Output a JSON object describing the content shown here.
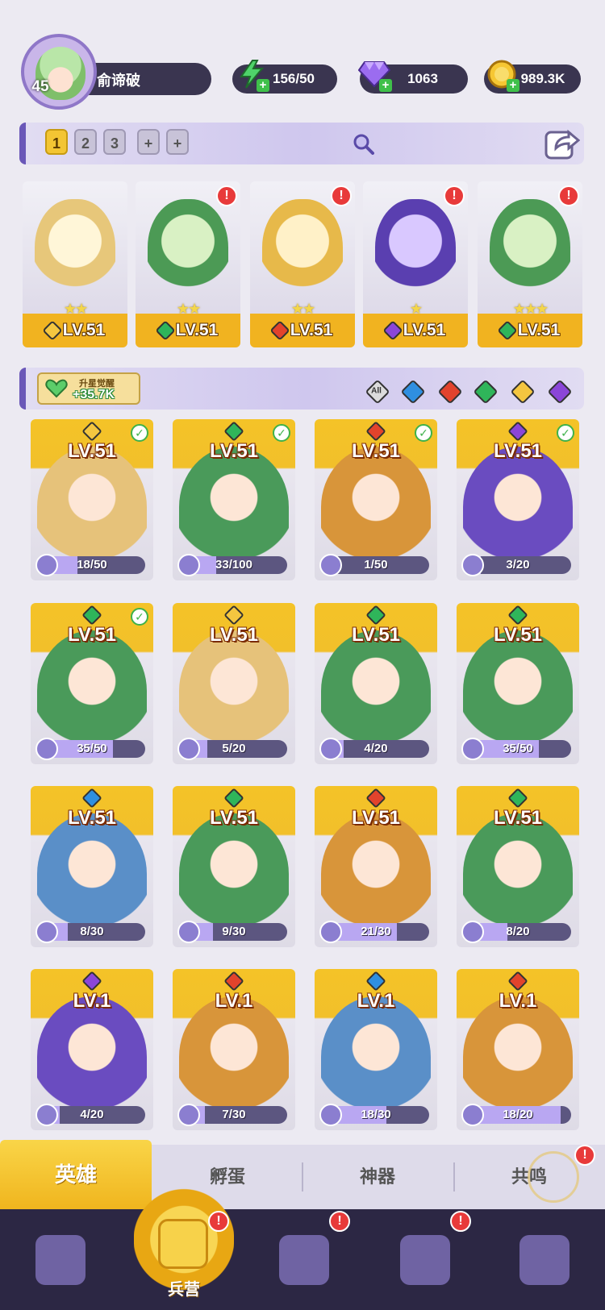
{
  "player": {
    "level": "45",
    "name": "俞谛破"
  },
  "resources": {
    "energy": "156/50",
    "gems": "1063",
    "gold": "989.3K"
  },
  "team_tabs": [
    "1",
    "2",
    "3",
    "+",
    "+"
  ],
  "team": [
    {
      "level": "LV.51",
      "element": "light",
      "stars": "★★",
      "alert": false
    },
    {
      "level": "LV.51",
      "element": "nature",
      "stars": "★★",
      "alert": true
    },
    {
      "level": "LV.51",
      "element": "fire",
      "stars": "★★",
      "alert": true
    },
    {
      "level": "LV.51",
      "element": "dark",
      "stars": "★",
      "alert": true
    },
    {
      "level": "LV.51",
      "element": "nature",
      "stars": "★★★",
      "alert": true
    }
  ],
  "awaken": {
    "title": "升星觉醒",
    "value": "+35.7K"
  },
  "filters": [
    "All",
    "water",
    "fire",
    "nature",
    "light",
    "dark"
  ],
  "filter_all_label": "All",
  "heroes": [
    {
      "level": "LV.51",
      "element": "light",
      "shards": "18/50",
      "fill": 0.36,
      "checked": true
    },
    {
      "level": "LV.51",
      "element": "nature",
      "shards": "33/100",
      "fill": 0.33,
      "checked": true
    },
    {
      "level": "LV.51",
      "element": "fire",
      "shards": "1/50",
      "fill": 0.02,
      "checked": true
    },
    {
      "level": "LV.51",
      "element": "dark",
      "shards": "3/20",
      "fill": 0.15,
      "checked": true
    },
    {
      "level": "LV.51",
      "element": "nature",
      "shards": "35/50",
      "fill": 0.7,
      "checked": true
    },
    {
      "level": "LV.51",
      "element": "light",
      "shards": "5/20",
      "fill": 0.25,
      "checked": false
    },
    {
      "level": "LV.51",
      "element": "nature",
      "shards": "4/20",
      "fill": 0.2,
      "checked": false
    },
    {
      "level": "LV.51",
      "element": "nature",
      "shards": "35/50",
      "fill": 0.7,
      "checked": false
    },
    {
      "level": "LV.51",
      "element": "water",
      "shards": "8/30",
      "fill": 0.27,
      "checked": false
    },
    {
      "level": "LV.51",
      "element": "nature",
      "shards": "9/30",
      "fill": 0.3,
      "checked": false
    },
    {
      "level": "LV.51",
      "element": "fire",
      "shards": "21/30",
      "fill": 0.7,
      "checked": false
    },
    {
      "level": "LV.51",
      "element": "nature",
      "shards": "8/20",
      "fill": 0.4,
      "checked": false
    },
    {
      "level": "LV.1",
      "element": "dark",
      "shards": "4/20",
      "fill": 0.2,
      "checked": false
    },
    {
      "level": "LV.1",
      "element": "fire",
      "shards": "7/30",
      "fill": 0.23,
      "checked": false
    },
    {
      "level": "LV.1",
      "element": "water",
      "shards": "18/30",
      "fill": 0.6,
      "checked": false
    },
    {
      "level": "LV.1",
      "element": "fire",
      "shards": "18/20",
      "fill": 0.9,
      "checked": false
    }
  ],
  "categories": [
    "英雄",
    "孵蛋",
    "神器",
    "共鸣"
  ],
  "nav": [
    {
      "icon": "cards-icon",
      "label": "",
      "alert": false
    },
    {
      "icon": "barracks-icon",
      "label": "兵营",
      "alert": true
    },
    {
      "icon": "map-icon",
      "label": "",
      "alert": true
    },
    {
      "icon": "castle-icon",
      "label": "",
      "alert": true
    },
    {
      "icon": "mushroom-house-icon",
      "label": "",
      "alert": false
    }
  ],
  "alert_symbol": "!",
  "check_symbol": "✓",
  "colors": {
    "light": "#f4c640",
    "nature": "#2fb55a",
    "fire": "#e2432c",
    "dark": "#8b46d8",
    "water": "#2f8fe0",
    "accent": "#f2c02a",
    "panel": "#3a3550"
  }
}
